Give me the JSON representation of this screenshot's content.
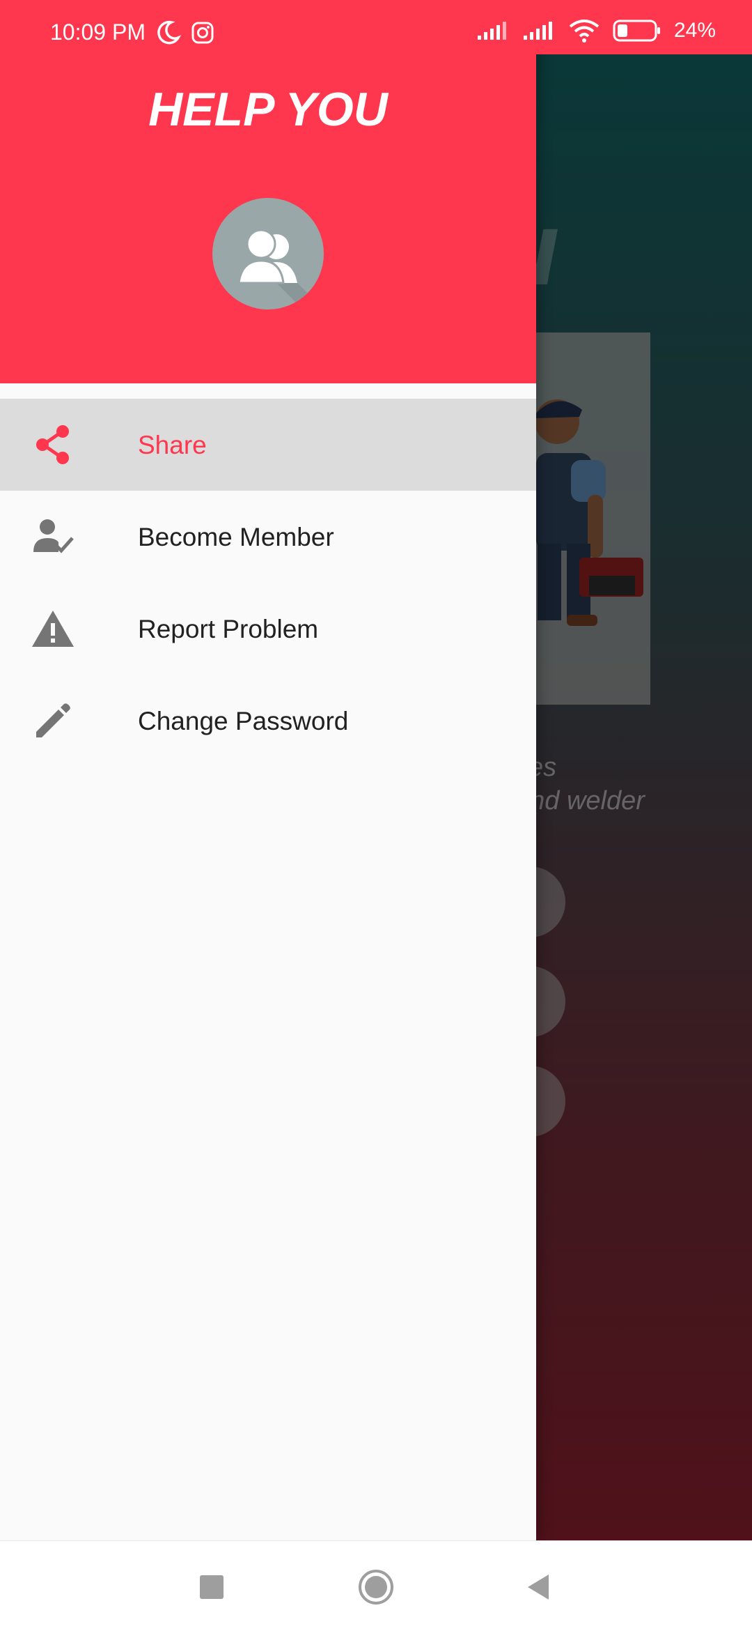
{
  "status_bar": {
    "time": "10:09 PM",
    "battery_percent": "24%",
    "icons": [
      "moon-icon",
      "instagram-icon",
      "signal-icon",
      "signal-icon",
      "wifi-icon",
      "battery-icon"
    ]
  },
  "drawer": {
    "app_title": "HELP YOU",
    "menu": [
      {
        "label": "Share",
        "icon": "share-icon",
        "active": true
      },
      {
        "label": "Become Member",
        "icon": "person-check-icon",
        "active": false
      },
      {
        "label": "Report Problem",
        "icon": "warning-icon",
        "active": false
      },
      {
        "label": "Change Password",
        "icon": "pencil-icon",
        "active": false
      }
    ]
  },
  "background": {
    "partial_letter": "u",
    "text_line1": "ces",
    "text_line2": "and welder"
  },
  "colors": {
    "accent": "#ff374e",
    "active_bg": "#dcdcdc",
    "icon_gray": "#757575"
  }
}
